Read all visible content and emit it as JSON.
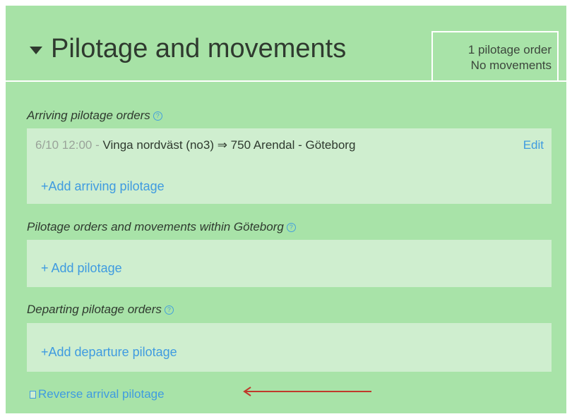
{
  "header": {
    "title": "Pilotage and movements",
    "summary_line1": "1 pilotage order",
    "summary_line2": "No movements"
  },
  "arriving": {
    "label": "Arriving pilotage orders",
    "order": {
      "time": "6/10 12:00",
      "separator": " - ",
      "route": "Vinga nordväst (no3) ⇒ 750 Arendal - Göteborg",
      "edit_label": "Edit"
    },
    "add_label": "+Add arriving pilotage"
  },
  "within": {
    "label": "Pilotage orders and movements within Göteborg",
    "add_label": "+ Add pilotage"
  },
  "departing": {
    "label": "Departing pilotage orders",
    "add_label": "+Add departure pilotage"
  },
  "reverse": {
    "label": "Reverse arrival pilotage"
  },
  "colors": {
    "panel": "#a8e3a8",
    "box": "#cfeecf",
    "link": "#3f9be0",
    "arrow": "#c0392b"
  },
  "icons": {
    "caret": "caret-down-icon",
    "help": "help-circle-icon",
    "reverse": "reverse-icon"
  }
}
